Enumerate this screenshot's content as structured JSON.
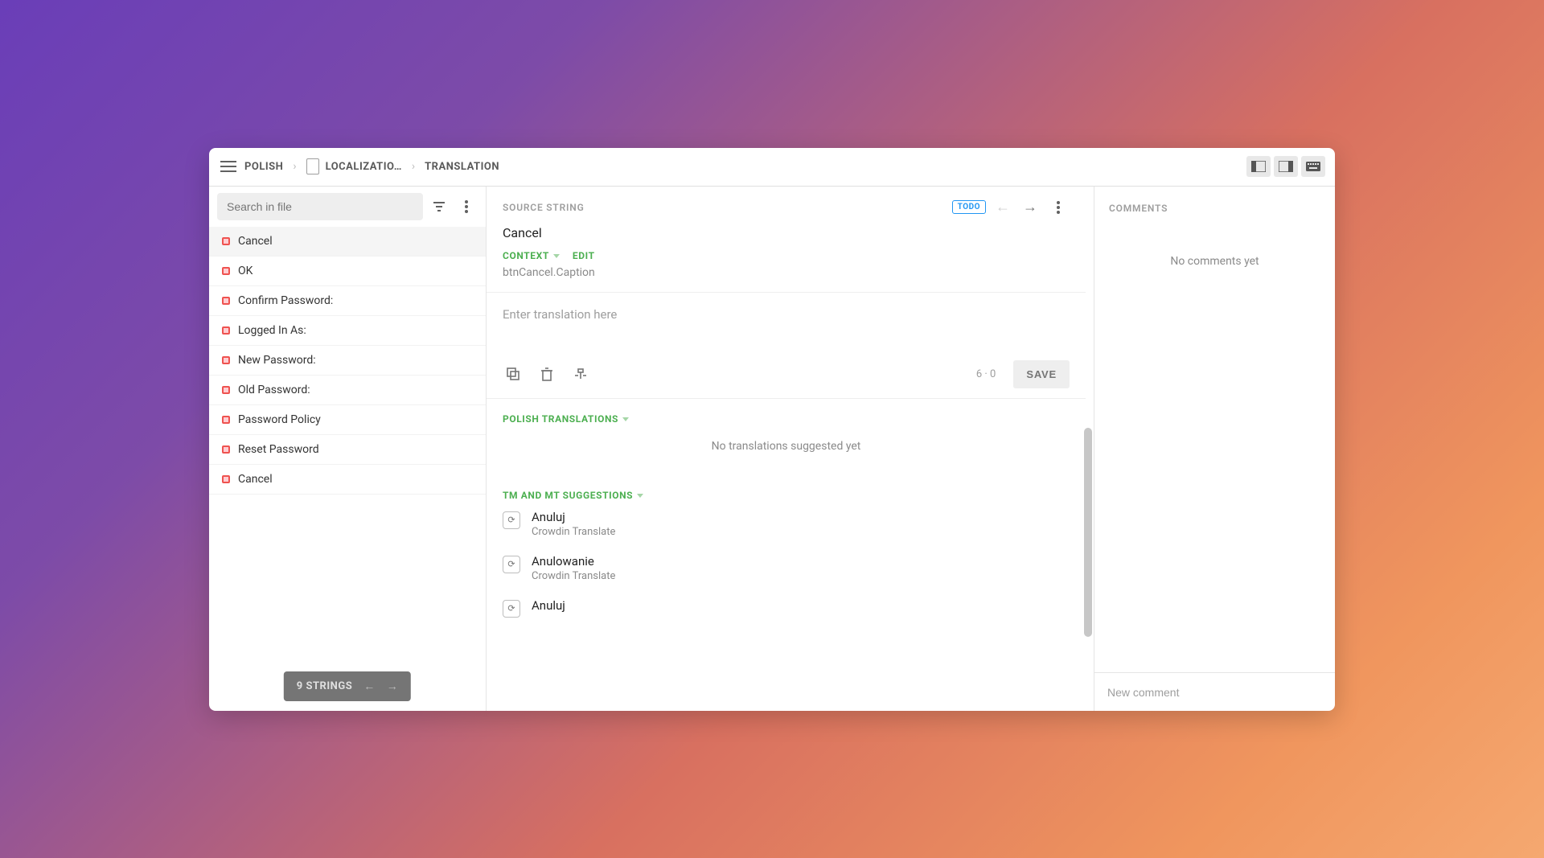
{
  "breadcrumb": {
    "language": "POLISH",
    "file": "LOCALIZATIO…",
    "section": "TRANSLATION"
  },
  "search": {
    "placeholder": "Search in file"
  },
  "strings": [
    {
      "label": "Cancel",
      "selected": true
    },
    {
      "label": "OK"
    },
    {
      "label": "Confirm Password:"
    },
    {
      "label": "Logged In As:"
    },
    {
      "label": "New Password:"
    },
    {
      "label": "Old Password:"
    },
    {
      "label": "Password Policy"
    },
    {
      "label": "Reset Password"
    },
    {
      "label": "Cancel"
    }
  ],
  "strings_footer": {
    "count_label": "9 STRINGS"
  },
  "source": {
    "heading": "SOURCE STRING",
    "text": "Cancel",
    "status_badge": "TODO",
    "context_label": "CONTEXT",
    "edit_label": "EDIT",
    "context_value": "btnCancel.Caption"
  },
  "translation": {
    "placeholder": "Enter translation here",
    "char_count": "6 · 0",
    "save_label": "SAVE"
  },
  "suggestions": {
    "translations_heading": "POLISH TRANSLATIONS",
    "no_translations": "No translations suggested yet",
    "tm_heading": "TM AND MT SUGGESTIONS",
    "items": [
      {
        "text": "Anuluj",
        "source": "Crowdin Translate"
      },
      {
        "text": "Anulowanie",
        "source": "Crowdin Translate"
      },
      {
        "text": "Anuluj",
        "source": ""
      }
    ]
  },
  "comments": {
    "heading": "COMMENTS",
    "empty": "No comments yet",
    "placeholder": "New comment"
  }
}
